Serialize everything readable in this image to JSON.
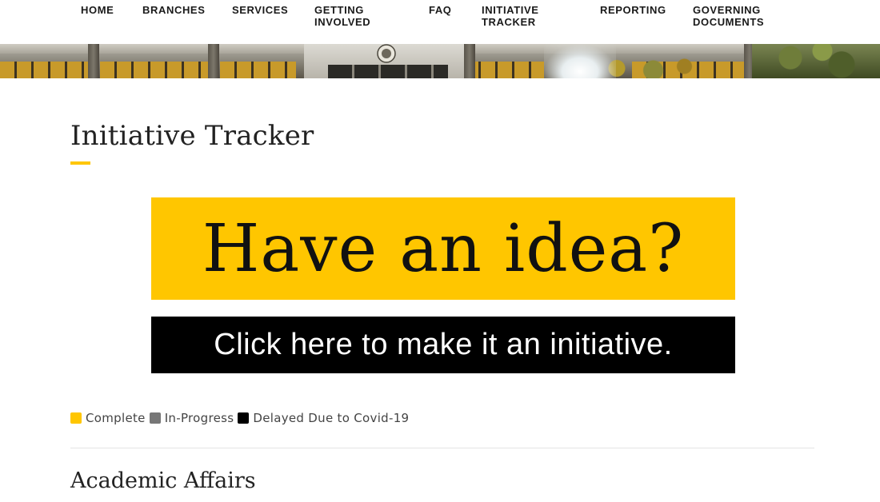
{
  "nav": {
    "items": [
      {
        "label": "HOME"
      },
      {
        "label": "BRANCHES"
      },
      {
        "label": "SERVICES"
      },
      {
        "label": "GETTING\nINVOLVED"
      },
      {
        "label": "FAQ"
      },
      {
        "label": "INITIATIVE\nTRACKER"
      },
      {
        "label": "REPORTING"
      },
      {
        "label": "GOVERNING\nDOCUMENTS"
      }
    ]
  },
  "page": {
    "title": "Initiative Tracker"
  },
  "cta": {
    "headline": "Have an idea?",
    "subline": "Click here to make it an initiative."
  },
  "legend": {
    "items": [
      {
        "label": "Complete",
        "color": "#ffc600"
      },
      {
        "label": "In-Progress",
        "color": "#777777"
      },
      {
        "label": "Delayed Due to Covid-19",
        "color": "#000000"
      }
    ]
  },
  "sections": [
    {
      "heading": "Academic Affairs"
    }
  ],
  "colors": {
    "accent": "#ffc600",
    "text": "#222222"
  }
}
